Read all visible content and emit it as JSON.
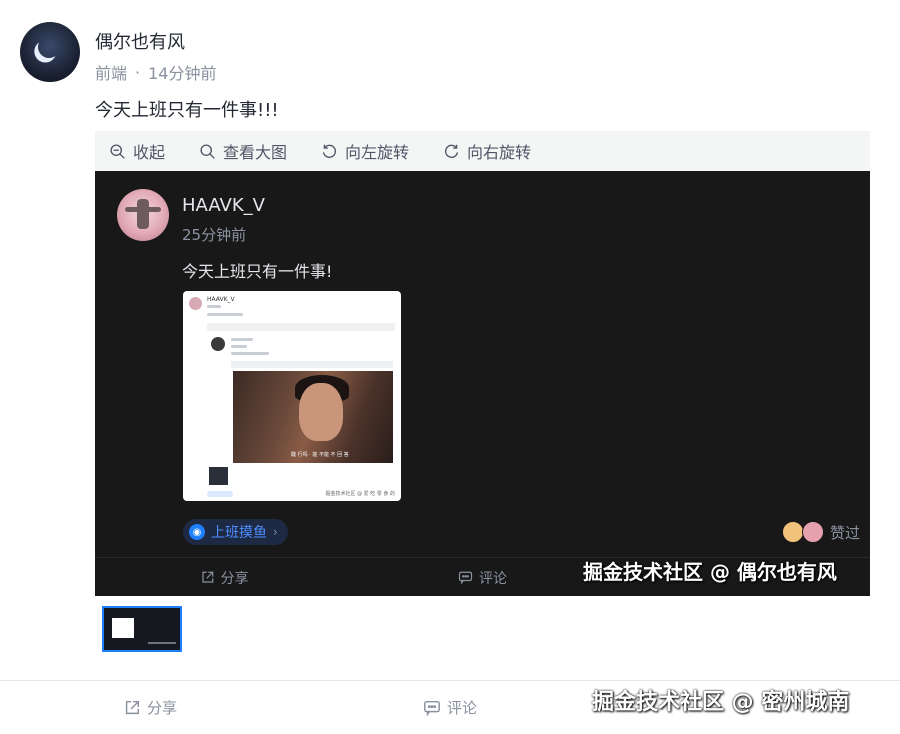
{
  "post": {
    "author": "偶尔也有风",
    "category": "前端",
    "dot": "·",
    "time": "14分钟前",
    "content": "今天上班只有一件事!!!"
  },
  "viewer": {
    "toolbar": {
      "collapse": "收起",
      "view_large": "查看大图",
      "rotate_left": "向左旋转",
      "rotate_right": "向右旋转"
    },
    "inner_post": {
      "author": "HAAVK_V",
      "time": "25分钟前",
      "content": "今天上班只有一件事!",
      "tag": "上班摸鱼",
      "liked": "赞过",
      "actions": {
        "share": "分享",
        "comment": "评论"
      },
      "thumb": {
        "author": "HAAVK_V",
        "subtitle": "酸 行吗 · 能 不能 不 回 答",
        "footer": "掘金技术社区 @ 爱 吃 零 食 的"
      }
    }
  },
  "actions": {
    "share": "分享",
    "comment": "评论"
  },
  "watermarks": {
    "inner": "掘金技术社区 @ 偶尔也有风",
    "outer": "掘金技术社区 @ 密州城南"
  },
  "colors": {
    "accent": "#1e80ff",
    "dark_bg": "#181818",
    "toolbar_bg": "#f4f5f5"
  },
  "icons": [
    "zoom-out-icon",
    "search-icon",
    "rotate-left-icon",
    "rotate-right-icon",
    "share-icon",
    "comment-icon"
  ]
}
